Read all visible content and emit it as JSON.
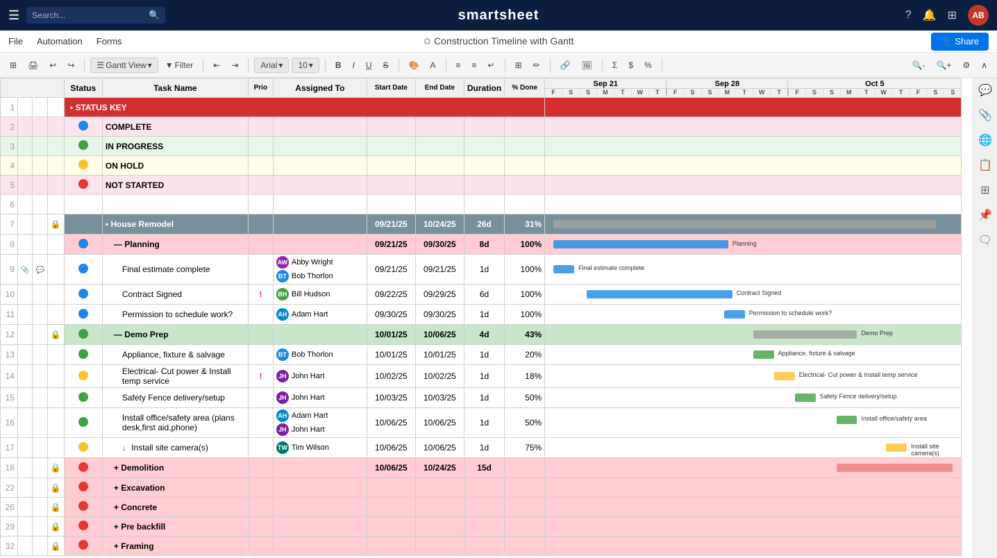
{
  "topNav": {
    "search_placeholder": "Search...",
    "brand": "smartsheet",
    "nav_icons": [
      "?",
      "🔔",
      "⊞"
    ],
    "avatar_initials": "AB"
  },
  "menuBar": {
    "items": [
      "File",
      "Automation",
      "Forms"
    ],
    "page_title": "✩  Construction Timeline with Gantt",
    "share_label": "Share"
  },
  "toolbar": {
    "view_label": "Gantt View",
    "filter_label": "Filter",
    "font_label": "Arial",
    "size_label": "10"
  },
  "columns": {
    "status": "Status",
    "task_name": "Task Name",
    "prio": "Prio",
    "assigned_to": "Assigned To",
    "start_date": "Start Date",
    "end_date": "End Date",
    "duration": "Duration",
    "pct_done": "% Done"
  },
  "ganttWeeks": [
    {
      "label": "Sep 21",
      "days": [
        "F",
        "S",
        "S",
        "M",
        "T",
        "W",
        "T"
      ]
    },
    {
      "label": "Sep 28",
      "days": [
        "F",
        "S",
        "S",
        "M",
        "T",
        "W",
        "T"
      ]
    },
    {
      "label": "Oct 5",
      "days": [
        "F",
        "S",
        "S",
        "M",
        "T",
        "W",
        "T",
        "F",
        "S",
        "S"
      ]
    }
  ],
  "rows": [
    {
      "rowNum": "1",
      "type": "status-key",
      "task": "STATUS KEY",
      "status_dot": "",
      "prio": "",
      "assign": [],
      "start": "",
      "end": "",
      "dur": "",
      "done": ""
    },
    {
      "rowNum": "2",
      "type": "complete",
      "task": "COMPLETE",
      "status_dot": "blue",
      "prio": "",
      "assign": [],
      "start": "",
      "end": "",
      "dur": "",
      "done": ""
    },
    {
      "rowNum": "3",
      "type": "in-progress",
      "task": "IN PROGRESS",
      "status_dot": "green",
      "prio": "",
      "assign": [],
      "start": "",
      "end": "",
      "dur": "",
      "done": ""
    },
    {
      "rowNum": "4",
      "type": "on-hold",
      "task": "ON HOLD",
      "status_dot": "yellow",
      "prio": "",
      "assign": [],
      "start": "",
      "end": "",
      "dur": "",
      "done": ""
    },
    {
      "rowNum": "5",
      "type": "not-started",
      "task": "NOT STARTED",
      "status_dot": "red",
      "prio": "",
      "assign": [],
      "start": "",
      "end": "",
      "dur": "",
      "done": ""
    },
    {
      "rowNum": "6",
      "type": "empty",
      "task": "",
      "status_dot": "",
      "prio": "",
      "assign": [],
      "start": "",
      "end": "",
      "dur": "",
      "done": ""
    },
    {
      "rowNum": "7",
      "type": "section",
      "task": "House Remodel",
      "status_dot": "",
      "prio": "",
      "assign": [],
      "start": "09/21/25",
      "end": "10/24/25",
      "dur": "26d",
      "done": "31%",
      "locked": true
    },
    {
      "rowNum": "8",
      "type": "subsection-red",
      "task": "Planning",
      "status_dot": "blue",
      "prio": "",
      "assign": [],
      "start": "09/21/25",
      "end": "09/30/25",
      "dur": "8d",
      "done": "100%"
    },
    {
      "rowNum": "9",
      "type": "normal",
      "task": "Final estimate complete",
      "status_dot": "blue",
      "prio": "",
      "assign": [
        {
          "initials": "AW",
          "color": "chip-aw",
          "name": "Abby Wright"
        },
        {
          "initials": "BT",
          "color": "chip-bt",
          "name": "Bob Thorlon"
        }
      ],
      "start": "09/21/25",
      "end": "09/21/25",
      "dur": "1d",
      "done": "100%"
    },
    {
      "rowNum": "10",
      "type": "normal",
      "task": "Contract Signed",
      "status_dot": "blue",
      "prio": "!",
      "assign": [
        {
          "initials": "BH",
          "color": "chip-bh",
          "name": "Bill Hudson"
        }
      ],
      "start": "09/22/25",
      "end": "09/29/25",
      "dur": "6d",
      "done": "100%"
    },
    {
      "rowNum": "11",
      "type": "normal",
      "task": "Permission to schedule work?",
      "status_dot": "blue",
      "prio": "",
      "assign": [
        {
          "initials": "AH",
          "color": "chip-ah",
          "name": "Adam Hart"
        }
      ],
      "start": "09/30/25",
      "end": "09/30/25",
      "dur": "1d",
      "done": "100%"
    },
    {
      "rowNum": "12",
      "type": "demo-prep",
      "task": "Demo Prep",
      "status_dot": "green",
      "prio": "",
      "assign": [],
      "start": "10/01/25",
      "end": "10/06/25",
      "dur": "4d",
      "done": "43%",
      "locked": true
    },
    {
      "rowNum": "13",
      "type": "normal",
      "task": "Appliance, fixture & salvage",
      "status_dot": "green",
      "prio": "",
      "assign": [
        {
          "initials": "BT",
          "color": "chip-bt",
          "name": "Bob Thorlon"
        }
      ],
      "start": "10/01/25",
      "end": "10/01/25",
      "dur": "1d",
      "done": "20%"
    },
    {
      "rowNum": "14",
      "type": "normal",
      "task": "Electrical- Cut power & Install temp service",
      "status_dot": "yellow",
      "prio": "!",
      "assign": [
        {
          "initials": "JH",
          "color": "chip-jh",
          "name": "John Hart"
        }
      ],
      "start": "10/02/25",
      "end": "10/02/25",
      "dur": "1d",
      "done": "18%"
    },
    {
      "rowNum": "15",
      "type": "normal",
      "task": "Safety Fence delivery/setup",
      "status_dot": "green",
      "prio": "",
      "assign": [
        {
          "initials": "JH",
          "color": "chip-jh",
          "name": "John Hart"
        }
      ],
      "start": "10/03/25",
      "end": "10/03/25",
      "dur": "1d",
      "done": "50%"
    },
    {
      "rowNum": "16",
      "type": "normal-2assign",
      "task": "Install office/safety area (plans desk,first aid,phone)",
      "status_dot": "green",
      "prio": "",
      "assign": [
        {
          "initials": "AH",
          "color": "chip-ah",
          "name": "Adam Hart"
        },
        {
          "initials": "JH",
          "color": "chip-jh",
          "name": "John Hart"
        }
      ],
      "start": "10/06/25",
      "end": "10/06/25",
      "dur": "1d",
      "done": "50%"
    },
    {
      "rowNum": "17",
      "type": "normal",
      "task": "Install site camera(s)",
      "status_dot": "yellow",
      "prio": "",
      "assign": [
        {
          "initials": "TW",
          "color": "chip-tw",
          "name": "Tim Wilson"
        }
      ],
      "start": "10/06/25",
      "end": "10/06/25",
      "dur": "1d",
      "done": "75%",
      "arrow": true
    },
    {
      "rowNum": "18",
      "type": "group-red",
      "task": "Demolition",
      "status_dot": "red",
      "prio": "",
      "assign": [],
      "start": "10/06/25",
      "end": "10/24/25",
      "dur": "15d",
      "done": "",
      "locked": true
    },
    {
      "rowNum": "22",
      "type": "group-red",
      "task": "Excavation",
      "status_dot": "red",
      "prio": "",
      "assign": [],
      "start": "",
      "end": "",
      "dur": "",
      "done": "",
      "locked": true
    },
    {
      "rowNum": "26",
      "type": "group-red",
      "task": "Concrete",
      "status_dot": "red",
      "prio": "",
      "assign": [],
      "start": "",
      "end": "",
      "dur": "",
      "done": "",
      "locked": true
    },
    {
      "rowNum": "29",
      "type": "group-red",
      "task": "Pre backfill",
      "status_dot": "red",
      "prio": "",
      "assign": [],
      "start": "",
      "end": "",
      "dur": "",
      "done": "",
      "locked": true
    },
    {
      "rowNum": "32",
      "type": "group-red",
      "task": "Framing",
      "status_dot": "red",
      "prio": "",
      "assign": [],
      "start": "",
      "end": "",
      "dur": "",
      "done": "",
      "locked": true
    }
  ]
}
